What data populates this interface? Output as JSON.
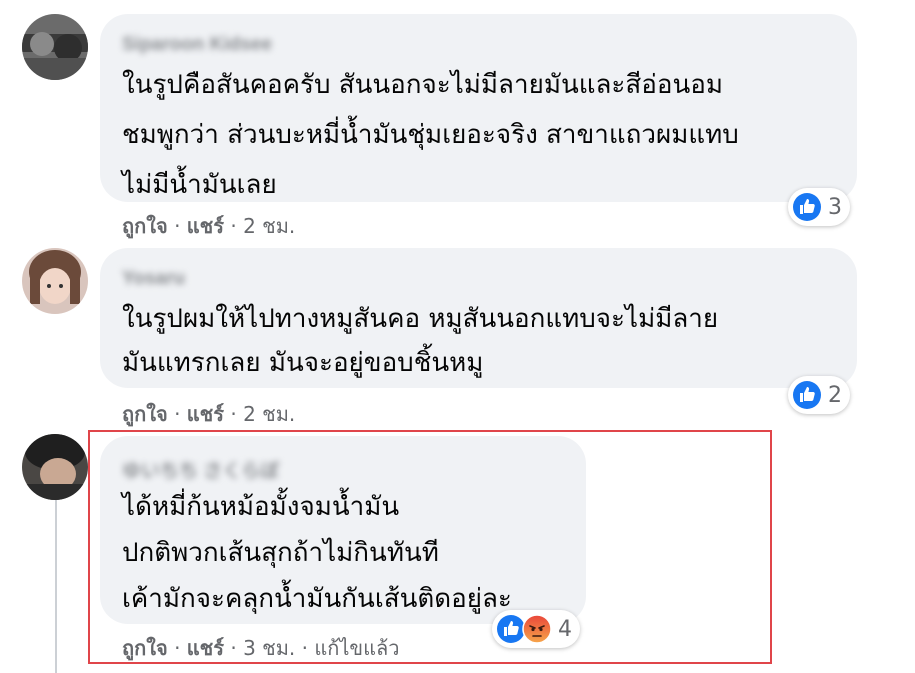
{
  "comments": [
    {
      "author": "Siparoon Kidsee",
      "lines": [
        "ในรูปคือสันคอครับ สันนอกจะไม่มีลายมันและสีอ่อนอม",
        "ชมพูกว่า ส่วนบะหมี่น้ำมันชุ่มเยอะจริง สาขาแถวผมแทบ",
        "ไม่มีน้ำมันเลย"
      ],
      "like_label": "ถูกใจ",
      "share_label": "แชร์",
      "time": "2 ชม.",
      "reaction_count": "3",
      "reactions": [
        "like-icon"
      ]
    },
    {
      "author": "Yosaru",
      "lines": [
        "ในรูปผมให้ไปทางหมูสันคอ หมูสันนอกแทบจะไม่มีลาย",
        "มันแทรกเลย มันจะอยู่ขอบชิ้นหมู"
      ],
      "like_label": "ถูกใจ",
      "share_label": "แชร์",
      "time": "2 ชม.",
      "reaction_count": "2",
      "reactions": [
        "like-icon"
      ]
    },
    {
      "author": "ゆいちち さくらぼ",
      "lines": [
        "ได้หมี่ก้นหม้อมั้งจมน้ำมัน",
        "ปกติพวกเส้นสุกถ้าไม่กินทันที",
        "เค้ามักจะคลุกน้ำมันกันเส้นติดอยู่ละ"
      ],
      "like_label": "ถูกใจ",
      "share_label": "แชร์",
      "time": "3 ชม.",
      "edited_label": "แก้ไขแล้ว",
      "reaction_count": "4",
      "reactions": [
        "like-icon",
        "angry-icon"
      ]
    }
  ],
  "separator": "·",
  "colors": {
    "like_blue": "#1877f2",
    "angry_orange": "#f7714c",
    "highlight_red": "#e0454a",
    "bubble_bg": "#f0f2f5"
  }
}
